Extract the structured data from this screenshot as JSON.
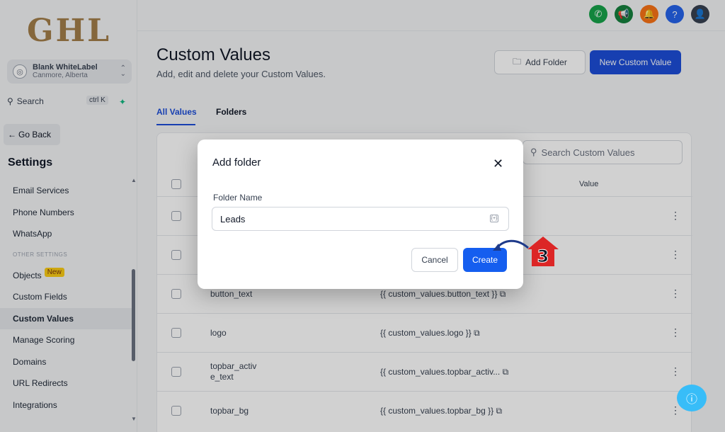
{
  "sidebar": {
    "logo": "GHL",
    "account_name": "Blank WhiteLabel",
    "account_location": "Canmore, Alberta",
    "search_label": "Search",
    "search_shortcut": "ctrl K",
    "go_back": "Go Back",
    "settings_title": "Settings",
    "items_top": [
      "Email Services",
      "Phone Numbers",
      "WhatsApp"
    ],
    "section_label": "OTHER SETTINGS",
    "items_bottom": [
      "Objects",
      "Custom Fields",
      "Custom Values",
      "Manage Scoring",
      "Domains",
      "URL Redirects",
      "Integrations"
    ],
    "objects_badge": "New",
    "active_item": "Custom Values"
  },
  "topbar": {
    "icons": [
      "phone-icon",
      "megaphone-icon",
      "bell-icon",
      "help-icon",
      "avatar"
    ],
    "colors": {
      "phone": "#16a34a",
      "megaphone": "#15803d",
      "bell": "#f97316",
      "help": "#2563eb"
    }
  },
  "page": {
    "title": "Custom Values",
    "subtitle": "Add, edit and delete your Custom Values.",
    "add_folder": "Add Folder",
    "new_custom_value": "New Custom Value",
    "tabs": [
      "All Values",
      "Folders"
    ],
    "active_tab": "All Values"
  },
  "table": {
    "search_placeholder": "Search Custom Values",
    "header_value": "Value",
    "rows": [
      {
        "name": "",
        "value": ""
      },
      {
        "name": "",
        "value": ""
      },
      {
        "name": "button_text",
        "value": "{{ custom_values.button_text }}"
      },
      {
        "name": "logo",
        "value": "{{ custom_values.logo }}"
      },
      {
        "name": "topbar_activ e_text",
        "value": "{{ custom_values.topbar_activ..."
      },
      {
        "name": "topbar_bg",
        "value": "{{ custom_values.topbar_bg }}"
      }
    ]
  },
  "modal": {
    "title": "Add folder",
    "field_label": "Folder Name",
    "field_value": "Leads",
    "cancel": "Cancel",
    "create": "Create"
  },
  "annotation": {
    "step_number": "3",
    "color": "#dc2626"
  },
  "colors": {
    "primary": "#1d4ed8",
    "create_button": "#155eef"
  }
}
